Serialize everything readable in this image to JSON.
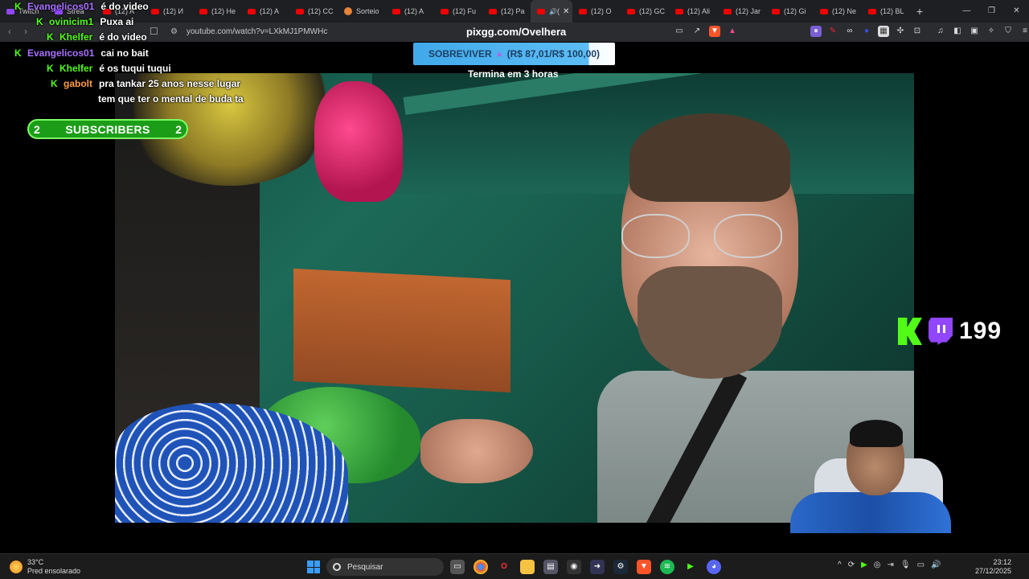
{
  "browser": {
    "tabs": [
      {
        "label": "Twitch",
        "kind": "twitch"
      },
      {
        "label": "Strea",
        "kind": "twitch"
      },
      {
        "label": "(12) A",
        "kind": "yt"
      },
      {
        "label": "(12) И",
        "kind": "yt"
      },
      {
        "label": "(12) He",
        "kind": "yt"
      },
      {
        "label": "(12) A",
        "kind": "yt"
      },
      {
        "label": "(12) CC",
        "kind": "yt"
      },
      {
        "label": "Sorteio",
        "kind": "sorteio"
      },
      {
        "label": "(12) A",
        "kind": "yt"
      },
      {
        "label": "(12) Fu",
        "kind": "yt"
      },
      {
        "label": "(12) Pa",
        "kind": "yt"
      },
      {
        "label": "(",
        "kind": "yt",
        "active": true
      },
      {
        "label": "(12) O",
        "kind": "yt"
      },
      {
        "label": "(12) GC",
        "kind": "yt"
      },
      {
        "label": "(12) Ali",
        "kind": "yt"
      },
      {
        "label": "(12) Jar",
        "kind": "yt"
      },
      {
        "label": "(12) Gi",
        "kind": "yt"
      },
      {
        "label": "(12) Ne",
        "kind": "yt"
      },
      {
        "label": "(12) BL",
        "kind": "yt"
      }
    ],
    "new_tab": "+",
    "url": "youtube.com/watch?v=LXkMJ1PMWHc"
  },
  "stream": {
    "domain": "pixgg.com/Ovelhera",
    "goal": {
      "label": "SOBREVIVER",
      "amount": "(R$ 87,01/R$ 100,00)",
      "progress": 0.87
    },
    "goal_end": "Termina em 3 horas",
    "subscribers": {
      "label": "SUBSCRIBERS",
      "left": "2",
      "right": "2"
    },
    "viewers": "199"
  },
  "chat": [
    {
      "user": "Evangelicos01",
      "msg": "é do video",
      "color": "purple",
      "kick": true
    },
    {
      "user": "ovinicim1",
      "msg": "Puxa ai",
      "color": "green",
      "kick": true
    },
    {
      "user": "Khelfer",
      "msg": "é do video",
      "color": "green",
      "kick": true
    },
    {
      "user": "Evangelicos01",
      "msg": "cai no bait",
      "color": "purple",
      "kick": true
    },
    {
      "user": "Khelfer",
      "msg": "é os tuqui tuqui",
      "color": "green",
      "kick": true
    },
    {
      "user": "gabolt",
      "msg": "pra tankar 25 anos nesse lugar",
      "color": "orange",
      "kick": true
    },
    {
      "user": "",
      "msg": "tem que ter o mental de buda ta",
      "color": "orange",
      "kick": false
    }
  ],
  "taskbar": {
    "temp": "33°C",
    "weather": "Pred ensolarado",
    "search": "Pesquisar",
    "time": "23:12",
    "date": "27/12/2025"
  },
  "colors": {
    "kick_green": "#53fc18",
    "twitch_purple": "#9146ff",
    "goal_blue": "#41a9ea"
  }
}
